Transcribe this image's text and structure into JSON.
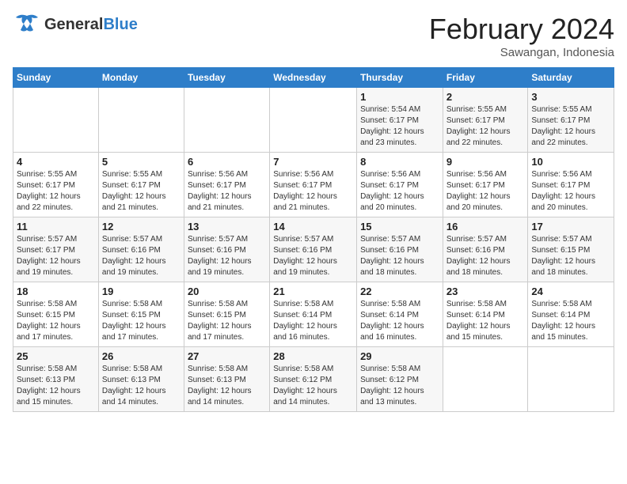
{
  "header": {
    "logo_general": "General",
    "logo_blue": "Blue",
    "month_title": "February 2024",
    "location": "Sawangan, Indonesia"
  },
  "weekdays": [
    "Sunday",
    "Monday",
    "Tuesday",
    "Wednesday",
    "Thursday",
    "Friday",
    "Saturday"
  ],
  "weeks": [
    [
      {
        "day": "",
        "info": ""
      },
      {
        "day": "",
        "info": ""
      },
      {
        "day": "",
        "info": ""
      },
      {
        "day": "",
        "info": ""
      },
      {
        "day": "1",
        "info": "Sunrise: 5:54 AM\nSunset: 6:17 PM\nDaylight: 12 hours\nand 23 minutes."
      },
      {
        "day": "2",
        "info": "Sunrise: 5:55 AM\nSunset: 6:17 PM\nDaylight: 12 hours\nand 22 minutes."
      },
      {
        "day": "3",
        "info": "Sunrise: 5:55 AM\nSunset: 6:17 PM\nDaylight: 12 hours\nand 22 minutes."
      }
    ],
    [
      {
        "day": "4",
        "info": "Sunrise: 5:55 AM\nSunset: 6:17 PM\nDaylight: 12 hours\nand 22 minutes."
      },
      {
        "day": "5",
        "info": "Sunrise: 5:55 AM\nSunset: 6:17 PM\nDaylight: 12 hours\nand 21 minutes."
      },
      {
        "day": "6",
        "info": "Sunrise: 5:56 AM\nSunset: 6:17 PM\nDaylight: 12 hours\nand 21 minutes."
      },
      {
        "day": "7",
        "info": "Sunrise: 5:56 AM\nSunset: 6:17 PM\nDaylight: 12 hours\nand 21 minutes."
      },
      {
        "day": "8",
        "info": "Sunrise: 5:56 AM\nSunset: 6:17 PM\nDaylight: 12 hours\nand 20 minutes."
      },
      {
        "day": "9",
        "info": "Sunrise: 5:56 AM\nSunset: 6:17 PM\nDaylight: 12 hours\nand 20 minutes."
      },
      {
        "day": "10",
        "info": "Sunrise: 5:56 AM\nSunset: 6:17 PM\nDaylight: 12 hours\nand 20 minutes."
      }
    ],
    [
      {
        "day": "11",
        "info": "Sunrise: 5:57 AM\nSunset: 6:17 PM\nDaylight: 12 hours\nand 19 minutes."
      },
      {
        "day": "12",
        "info": "Sunrise: 5:57 AM\nSunset: 6:16 PM\nDaylight: 12 hours\nand 19 minutes."
      },
      {
        "day": "13",
        "info": "Sunrise: 5:57 AM\nSunset: 6:16 PM\nDaylight: 12 hours\nand 19 minutes."
      },
      {
        "day": "14",
        "info": "Sunrise: 5:57 AM\nSunset: 6:16 PM\nDaylight: 12 hours\nand 19 minutes."
      },
      {
        "day": "15",
        "info": "Sunrise: 5:57 AM\nSunset: 6:16 PM\nDaylight: 12 hours\nand 18 minutes."
      },
      {
        "day": "16",
        "info": "Sunrise: 5:57 AM\nSunset: 6:16 PM\nDaylight: 12 hours\nand 18 minutes."
      },
      {
        "day": "17",
        "info": "Sunrise: 5:57 AM\nSunset: 6:15 PM\nDaylight: 12 hours\nand 18 minutes."
      }
    ],
    [
      {
        "day": "18",
        "info": "Sunrise: 5:58 AM\nSunset: 6:15 PM\nDaylight: 12 hours\nand 17 minutes."
      },
      {
        "day": "19",
        "info": "Sunrise: 5:58 AM\nSunset: 6:15 PM\nDaylight: 12 hours\nand 17 minutes."
      },
      {
        "day": "20",
        "info": "Sunrise: 5:58 AM\nSunset: 6:15 PM\nDaylight: 12 hours\nand 17 minutes."
      },
      {
        "day": "21",
        "info": "Sunrise: 5:58 AM\nSunset: 6:14 PM\nDaylight: 12 hours\nand 16 minutes."
      },
      {
        "day": "22",
        "info": "Sunrise: 5:58 AM\nSunset: 6:14 PM\nDaylight: 12 hours\nand 16 minutes."
      },
      {
        "day": "23",
        "info": "Sunrise: 5:58 AM\nSunset: 6:14 PM\nDaylight: 12 hours\nand 15 minutes."
      },
      {
        "day": "24",
        "info": "Sunrise: 5:58 AM\nSunset: 6:14 PM\nDaylight: 12 hours\nand 15 minutes."
      }
    ],
    [
      {
        "day": "25",
        "info": "Sunrise: 5:58 AM\nSunset: 6:13 PM\nDaylight: 12 hours\nand 15 minutes."
      },
      {
        "day": "26",
        "info": "Sunrise: 5:58 AM\nSunset: 6:13 PM\nDaylight: 12 hours\nand 14 minutes."
      },
      {
        "day": "27",
        "info": "Sunrise: 5:58 AM\nSunset: 6:13 PM\nDaylight: 12 hours\nand 14 minutes."
      },
      {
        "day": "28",
        "info": "Sunrise: 5:58 AM\nSunset: 6:12 PM\nDaylight: 12 hours\nand 14 minutes."
      },
      {
        "day": "29",
        "info": "Sunrise: 5:58 AM\nSunset: 6:12 PM\nDaylight: 12 hours\nand 13 minutes."
      },
      {
        "day": "",
        "info": ""
      },
      {
        "day": "",
        "info": ""
      }
    ]
  ]
}
